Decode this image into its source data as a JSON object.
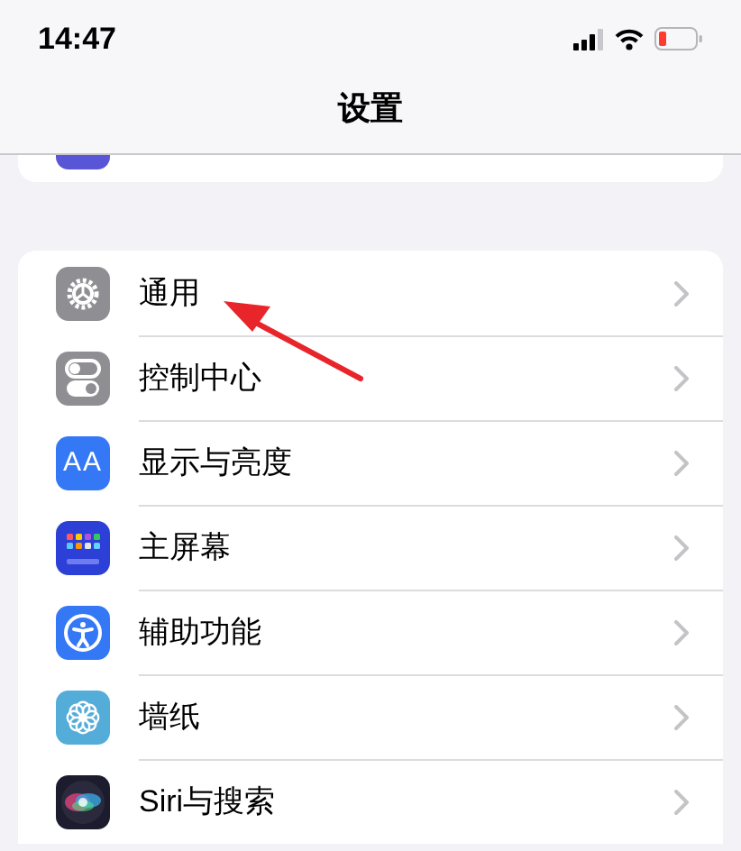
{
  "status_bar": {
    "time": "14:47"
  },
  "nav": {
    "title": "设置"
  },
  "partial_row": {
    "color": "#5856d6"
  },
  "rows": [
    {
      "label": "通用",
      "kind": "gear",
      "color": "#8e8e93"
    },
    {
      "label": "控制中心",
      "kind": "toggles",
      "color": "#8e8e93"
    },
    {
      "label": "显示与亮度",
      "kind": "text",
      "icon_text": "AA",
      "color": "#3478f6"
    },
    {
      "label": "主屏幕",
      "kind": "grid",
      "color": "#2c3fd6"
    },
    {
      "label": "辅助功能",
      "kind": "accessibility",
      "color": "#3478f6"
    },
    {
      "label": "墙纸",
      "kind": "flower",
      "color": "#54acd9"
    },
    {
      "label": "Siri与搜索",
      "kind": "siri",
      "color": "#1c1c2e"
    }
  ]
}
